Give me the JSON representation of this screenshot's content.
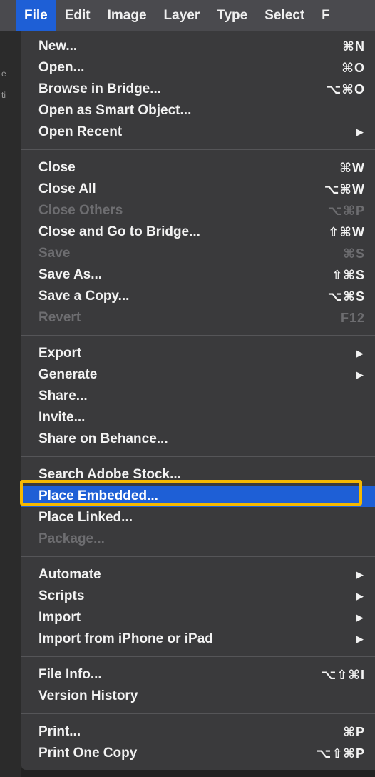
{
  "menubar": {
    "items": [
      "File",
      "Edit",
      "Image",
      "Layer",
      "Type",
      "Select",
      "F"
    ]
  },
  "left_edge": {
    "frag1": "e",
    "frag2": "ti"
  },
  "menu": {
    "groups": [
      [
        {
          "label": "New...",
          "shortcut": "⌘N",
          "enabled": true
        },
        {
          "label": "Open...",
          "shortcut": "⌘O",
          "enabled": true
        },
        {
          "label": "Browse in Bridge...",
          "shortcut": "⌥⌘O",
          "enabled": true
        },
        {
          "label": "Open as Smart Object...",
          "shortcut": "",
          "enabled": true
        },
        {
          "label": "Open Recent",
          "shortcut": "",
          "submenu": true,
          "enabled": true
        }
      ],
      [
        {
          "label": "Close",
          "shortcut": "⌘W",
          "enabled": true
        },
        {
          "label": "Close All",
          "shortcut": "⌥⌘W",
          "enabled": true
        },
        {
          "label": "Close Others",
          "shortcut": "⌥⌘P",
          "enabled": false
        },
        {
          "label": "Close and Go to Bridge...",
          "shortcut": "⇧⌘W",
          "enabled": true
        },
        {
          "label": "Save",
          "shortcut": "⌘S",
          "enabled": false
        },
        {
          "label": "Save As...",
          "shortcut": "⇧⌘S",
          "enabled": true
        },
        {
          "label": "Save a Copy...",
          "shortcut": "⌥⌘S",
          "enabled": true
        },
        {
          "label": "Revert",
          "shortcut": "F12",
          "enabled": false
        }
      ],
      [
        {
          "label": "Export",
          "shortcut": "",
          "submenu": true,
          "enabled": true
        },
        {
          "label": "Generate",
          "shortcut": "",
          "submenu": true,
          "enabled": true
        },
        {
          "label": "Share...",
          "shortcut": "",
          "enabled": true
        },
        {
          "label": "Invite...",
          "shortcut": "",
          "enabled": true
        },
        {
          "label": "Share on Behance...",
          "shortcut": "",
          "enabled": true
        }
      ],
      [
        {
          "label": "Search Adobe Stock...",
          "shortcut": "",
          "enabled": true
        },
        {
          "label": "Place Embedded...",
          "shortcut": "",
          "enabled": true,
          "highlighted": true
        },
        {
          "label": "Place Linked...",
          "shortcut": "",
          "enabled": true
        },
        {
          "label": "Package...",
          "shortcut": "",
          "enabled": false
        }
      ],
      [
        {
          "label": "Automate",
          "shortcut": "",
          "submenu": true,
          "enabled": true
        },
        {
          "label": "Scripts",
          "shortcut": "",
          "submenu": true,
          "enabled": true
        },
        {
          "label": "Import",
          "shortcut": "",
          "submenu": true,
          "enabled": true
        },
        {
          "label": "Import from iPhone or iPad",
          "shortcut": "",
          "submenu": true,
          "enabled": true
        }
      ],
      [
        {
          "label": "File Info...",
          "shortcut": "⌥⇧⌘I",
          "enabled": true
        },
        {
          "label": "Version History",
          "shortcut": "",
          "enabled": true
        }
      ],
      [
        {
          "label": "Print...",
          "shortcut": "⌘P",
          "enabled": true
        },
        {
          "label": "Print One Copy",
          "shortcut": "⌥⇧⌘P",
          "enabled": true
        }
      ]
    ]
  },
  "colors": {
    "menubar_bg": "#4a4a4e",
    "menu_bg": "#3a3a3c",
    "highlight": "#1e5fd6",
    "focus_outline": "#f5b800",
    "disabled_text": "#6d6d70"
  }
}
